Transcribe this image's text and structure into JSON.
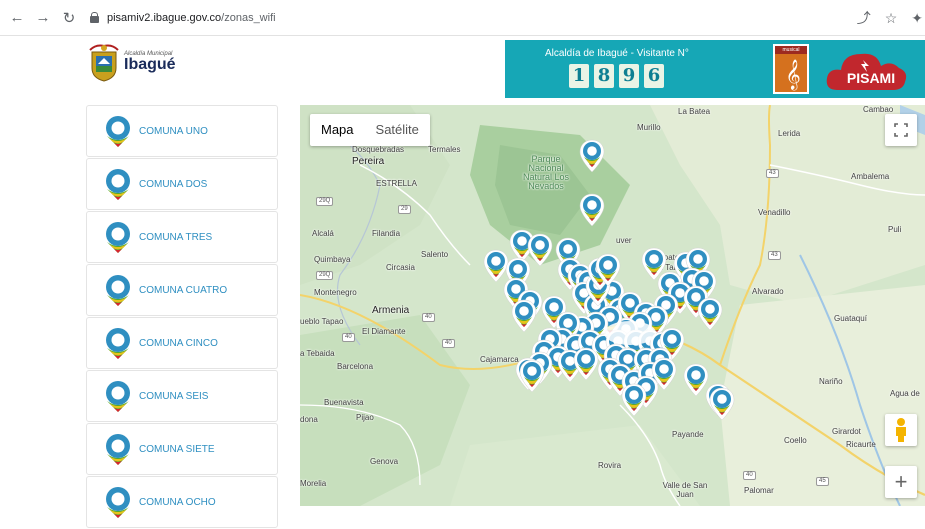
{
  "browser": {
    "url_host": "pisamiv2.ibague.gov.co",
    "url_path": "/zonas_wifi"
  },
  "header": {
    "logo_small": "Alcaldía Municipal",
    "logo_big": "Ibagué",
    "visitor_label": "Alcaldía de Ibagué - Visitante N°",
    "visitor_digits": [
      "1",
      "8",
      "9",
      "6"
    ],
    "music_label": "musical",
    "pisami_label": "PISAMI"
  },
  "sidebar": {
    "items": [
      {
        "label": "COMUNA UNO"
      },
      {
        "label": "COMUNA DOS"
      },
      {
        "label": "COMUNA TRES"
      },
      {
        "label": "COMUNA CUATRO"
      },
      {
        "label": "COMUNA CINCO"
      },
      {
        "label": "COMUNA SEIS"
      },
      {
        "label": "COMUNA SIETE"
      },
      {
        "label": "COMUNA OCHO"
      }
    ]
  },
  "map": {
    "type_options": [
      "Mapa",
      "Satélite"
    ],
    "selected_type": "Mapa",
    "zoom_in_label": "+",
    "places": {
      "la_batea": "La Batea",
      "cambao": "Cambao",
      "murillo": "Murillo",
      "lerida": "Lerida",
      "dosquebradas": "Dosquebradas",
      "termales": "Termales",
      "pereira": "Pereira",
      "parque": "Parque Nacional Natural Los Nevados",
      "ambalema": "Ambalema",
      "estrella": "ESTRELLA",
      "venadillo": "Venadillo",
      "puli": "Puli",
      "alcala": "Alcalá",
      "filandia": "Filandia",
      "salento": "Salento",
      "anzoategui": "Anzoategui",
      "el_tabor": "El Tabor",
      "quimbaya": "Quimbaya",
      "circasia": "Circasia",
      "montenegro": "Montenegro",
      "armenia": "Armenia",
      "alvarado": "Alvarado",
      "pueblo_tapao": "ueblo Tapao",
      "el_diamante": "El Diamante",
      "guataqui": "Guataquí",
      "la_tebaida": "a Tebaida",
      "cajamarca": "Cajamarca",
      "barcelona": "Barcelona",
      "narino": "Nariño",
      "agua_de": "Agua de",
      "buenavista": "Buenavista",
      "cordoba": "dona",
      "pijao": "Pijao",
      "payande": "Payande",
      "coello": "Coello",
      "girardot": "Girardot",
      "ricaurte": "Ricaurte",
      "genova": "Genova",
      "rovira": "Rovira",
      "morelia": "Morelia",
      "valle_de_san_juan": "Valle de San Juan",
      "palomar": "Palomar",
      "juver": "uver"
    },
    "road_badges": [
      "29Q",
      "29",
      "29Q",
      "40",
      "40",
      "40",
      "43",
      "43",
      "40",
      "45"
    ]
  },
  "colors": {
    "banner": "#16a7b6",
    "marker_blue": "#2f8fc1",
    "link_blue": "#2f8fc1",
    "map_green": "#cfe3c6"
  }
}
